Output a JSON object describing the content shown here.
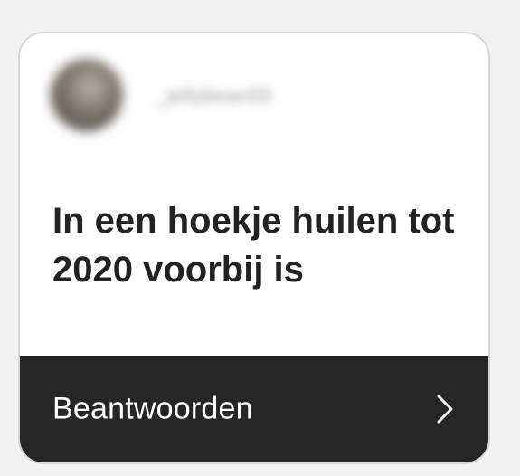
{
  "card": {
    "username": "_jellybean55",
    "question": "In een hoekje huilen tot 2020 voorbij is",
    "reply_label": "Beantwoorden"
  },
  "icons": {
    "avatar": "profile-avatar",
    "reply_arrow": "chevron-right-icon"
  },
  "colors": {
    "background": "#f2f2f2",
    "card": "#ffffff",
    "card_border": "#d6d6d6",
    "question_text": "#222222",
    "reply_bar": "#262626",
    "reply_text": "#ffffff"
  }
}
